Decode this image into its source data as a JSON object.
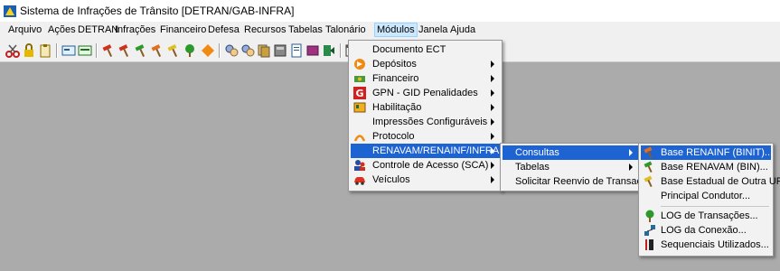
{
  "window": {
    "title": "Sistema de Infrações de Trânsito [DETRAN/GAB-INFRA]"
  },
  "menubar": [
    {
      "label": "Arquivo"
    },
    {
      "label": "Ações"
    },
    {
      "label": "DETRAN"
    },
    {
      "label": "Infrações"
    },
    {
      "label": "Financeiro"
    },
    {
      "label": "Defesa"
    },
    {
      "label": "Recursos"
    },
    {
      "label": "Tabelas"
    },
    {
      "label": "Talonário"
    },
    {
      "label": "Módulos"
    },
    {
      "label": "Janela"
    },
    {
      "label": "Ajuda"
    }
  ],
  "menus": {
    "modulos": [
      {
        "label": "Documento ECT",
        "icon": "none",
        "submenu": false
      },
      {
        "label": "Depósitos",
        "icon": "orange-arrow-icon",
        "submenu": true
      },
      {
        "label": "Financeiro",
        "icon": "money-icon",
        "submenu": true
      },
      {
        "label": "GPN - GID Penalidades",
        "icon": "g-red-icon",
        "submenu": true
      },
      {
        "label": "Habilitação",
        "icon": "license-icon",
        "submenu": true
      },
      {
        "label": "Impressões Configuráveis",
        "icon": "none",
        "submenu": true
      },
      {
        "label": "Protocolo",
        "icon": "protocol-icon",
        "submenu": true
      },
      {
        "label": "RENAVAM/RENAINF/INFRAEST",
        "icon": "none",
        "submenu": true
      },
      {
        "label": "Controle de Acesso (SCA)",
        "icon": "users-icon",
        "submenu": true
      },
      {
        "label": "Veículos",
        "icon": "car-icon",
        "submenu": true
      }
    ],
    "renavam": [
      {
        "label": "Consultas",
        "submenu": true
      },
      {
        "label": "Tabelas",
        "submenu": true
      },
      {
        "label": "Solicitar Reenvio de Transação",
        "submenu": false
      }
    ],
    "consultas": [
      {
        "label": "Base RENAINF (BINIT)...",
        "icon": "hammer-orange-icon"
      },
      {
        "label": "Base RENAVAM (BIN)...",
        "icon": "hammer-green-icon"
      },
      {
        "label": "Base Estadual de Outra UF...",
        "icon": "hammer-yellow-icon"
      },
      {
        "label": "Principal Condutor...",
        "icon": "none"
      },
      {
        "label": "LOG de Transações...",
        "icon": "tree-icon"
      },
      {
        "label": "LOG da Conexão...",
        "icon": "network-icon"
      },
      {
        "label": "Sequenciais Utilizados...",
        "icon": "sequence-icon"
      }
    ]
  },
  "colors": {
    "highlight": "#1d63d1",
    "workspace": "#ababab"
  }
}
